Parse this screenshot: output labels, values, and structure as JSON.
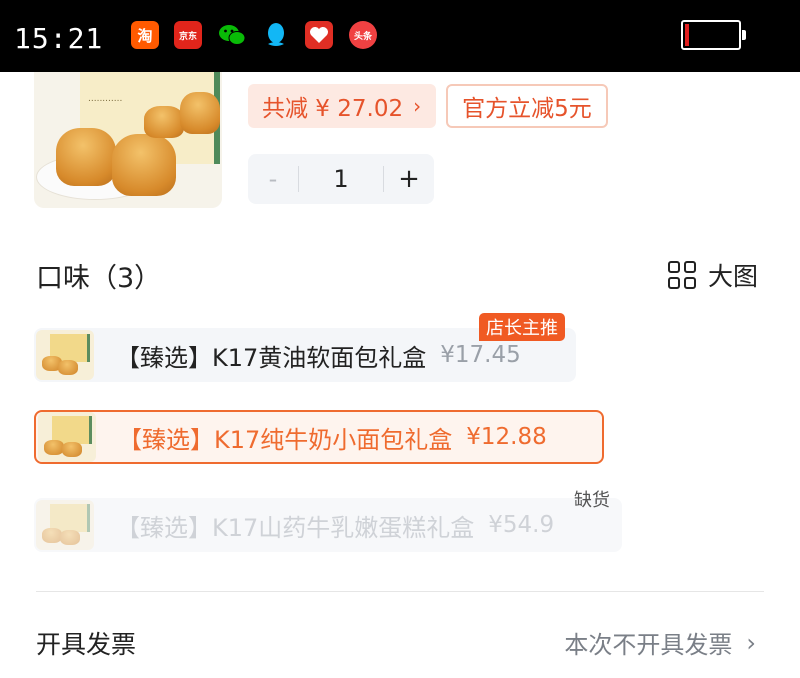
{
  "status_bar": {
    "time": "15:21",
    "apps": [
      {
        "icon": "taobao-icon",
        "text": "淘",
        "color": "#ff5a00"
      },
      {
        "icon": "jd-icon",
        "text": "京东",
        "color": "#e1251b"
      },
      {
        "icon": "wechat-icon",
        "text": "",
        "color": "#09bb07"
      },
      {
        "icon": "qq-icon",
        "text": "",
        "color": "#12b7f5"
      },
      {
        "icon": "pinduoduo-icon",
        "text": "",
        "color": "#e02e24"
      },
      {
        "icon": "toutiao-icon",
        "text": "头条",
        "color": "#f04142"
      }
    ]
  },
  "product": {
    "discount_tag": "共减 ¥ 27.02",
    "discount_chevron": "›",
    "official_tag": "官方立减5元",
    "quantity": "1",
    "minus": "-",
    "plus": "+"
  },
  "flavor": {
    "title": "口味（3）",
    "big_picture_label": "大图",
    "options": [
      {
        "label": "【臻选】K17黄油软面包礼盒",
        "price": "¥17.45",
        "badge": "店长主推",
        "state": "normal"
      },
      {
        "label": "【臻选】K17纯牛奶小面包礼盒",
        "price": "¥12.88",
        "state": "selected"
      },
      {
        "label": "【臻选】K17山药牛乳嫩蛋糕礼盒",
        "price": "¥54.9",
        "badge": "缺货",
        "state": "out_of_stock"
      }
    ]
  },
  "invoice": {
    "label": "开具发票",
    "value": "本次不开具发票",
    "chevron": "›"
  },
  "colors": {
    "accent": "#ef6b2f",
    "discount_text": "#e6532b",
    "hot_badge": "#f05a23"
  }
}
